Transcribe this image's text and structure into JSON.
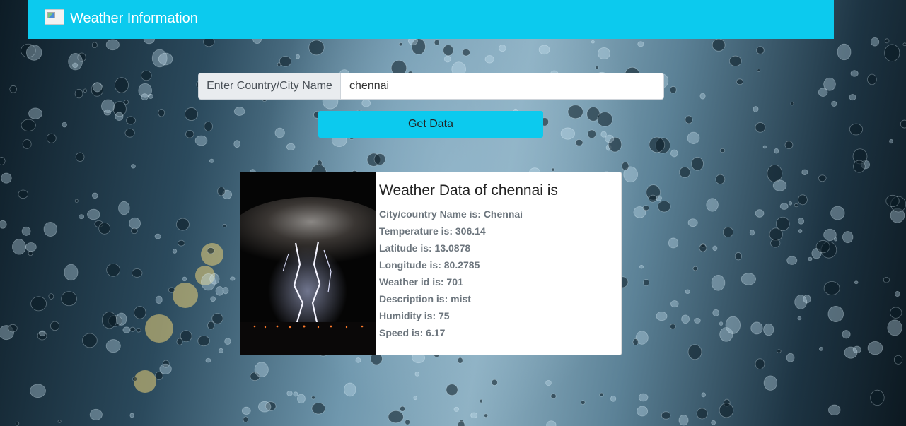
{
  "navbar": {
    "brand_text": "Weather Information"
  },
  "search": {
    "prepend_label": "Enter Country/City Name",
    "value": "chennai",
    "button_label": "Get Data"
  },
  "card": {
    "title": "Weather Data of chennai is",
    "lines": [
      "City/country Name is: Chennai",
      "Temperature is: 306.14",
      "Latitude is: 13.0878",
      "Longitude is: 80.2785",
      "Weather id is: 701",
      "Description is: mist",
      "Humidity is: 75",
      "Speed is: 6.17"
    ]
  },
  "colors": {
    "accent": "#0ccaee",
    "text_muted": "#6c757d"
  }
}
